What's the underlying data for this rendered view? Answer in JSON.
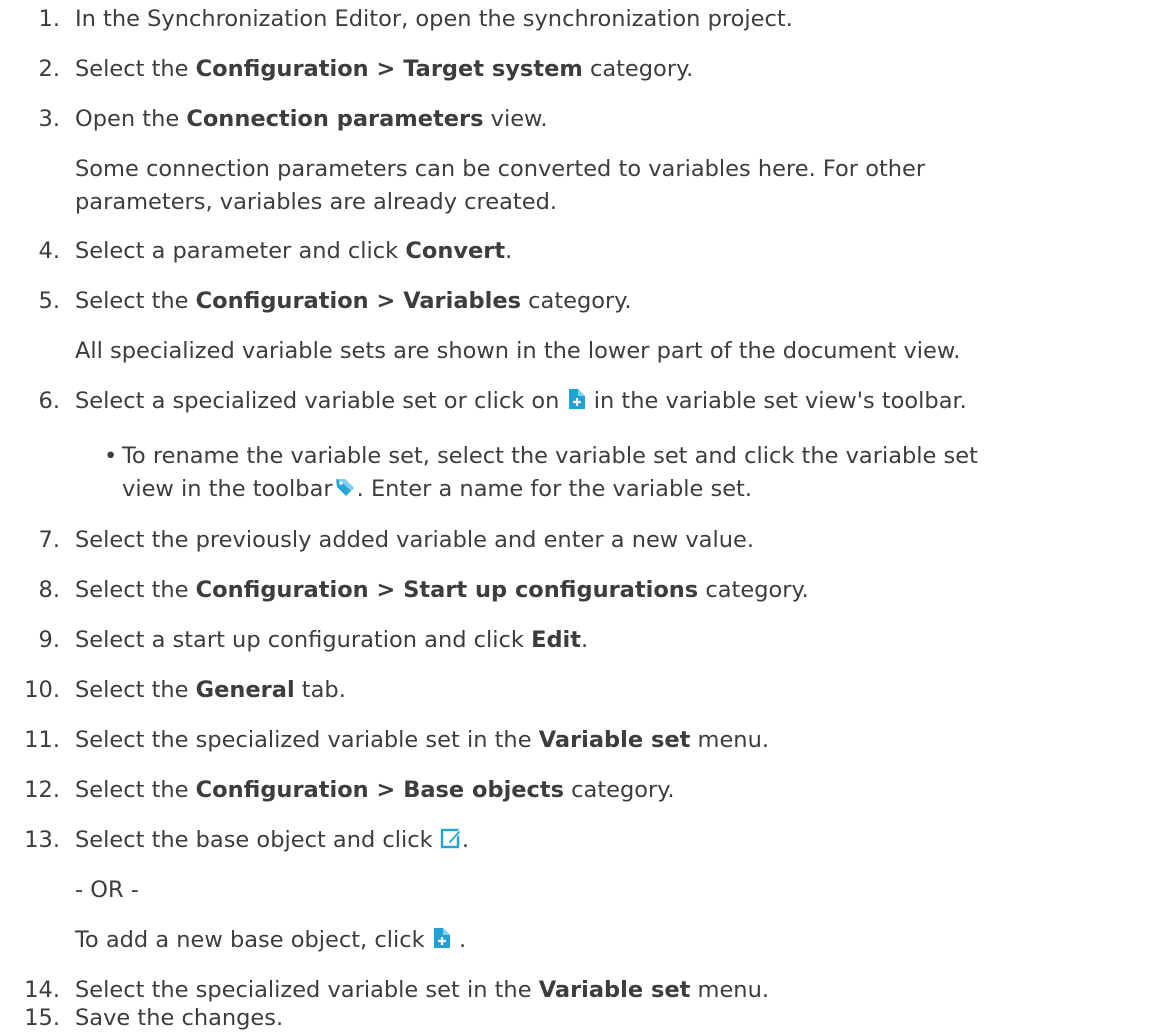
{
  "steps": [
    {
      "n": "1.",
      "parts": [
        "In the Synchronization Editor, open the synchronization project."
      ]
    },
    {
      "n": "2.",
      "parts": [
        "Select the ",
        "Configuration > Target system",
        " category."
      ]
    },
    {
      "n": "3.",
      "parts": [
        "Open the ",
        "Connection parameters",
        " view."
      ],
      "note": [
        "Some connection parameters can be converted to variables here. For other",
        "parameters, variables are already created."
      ]
    },
    {
      "n": "4.",
      "parts": [
        "Select a parameter and click ",
        "Convert",
        "."
      ]
    },
    {
      "n": "5.",
      "parts": [
        "Select the ",
        "Configuration > Variables",
        " category."
      ],
      "note": [
        "All specialized variable sets are shown in the lower part of the document view."
      ]
    },
    {
      "n": "6.",
      "parts": [
        "Select a specialized variable set or click on ",
        " in the variable set view's toolbar."
      ],
      "bullet": [
        "To rename the variable set, select the variable set and click the variable set",
        "view in the toolbar",
        ". Enter a name for the variable set."
      ]
    },
    {
      "n": "7.",
      "parts": [
        "Select the previously added variable and enter a new value."
      ]
    },
    {
      "n": "8.",
      "parts": [
        "Select the ",
        "Configuration > Start up configurations",
        " category."
      ]
    },
    {
      "n": "9.",
      "parts": [
        "Select a start up configuration and click ",
        "Edit",
        "."
      ]
    },
    {
      "n": "10.",
      "parts": [
        "Select the ",
        "General",
        " tab."
      ]
    },
    {
      "n": "11.",
      "parts": [
        "Select the specialized variable set in the ",
        "Variable set",
        " menu."
      ]
    },
    {
      "n": "12.",
      "parts": [
        "Select the ",
        "Configuration > Base objects",
        " category."
      ]
    },
    {
      "n": "13.",
      "parts": [
        "Select the base object and click ",
        "."
      ],
      "or": "- OR -",
      "alt": [
        "To add a new base object, click ",
        " ."
      ]
    },
    {
      "n": "14.",
      "parts": [
        "Select the specialized variable set in the ",
        "Variable set",
        " menu."
      ]
    },
    {
      "n": "15.",
      "parts": [
        "Save the changes."
      ]
    }
  ],
  "icons": {
    "add": {
      "name": "add-document-icon",
      "color": "#1fa3d6"
    },
    "tag": {
      "name": "tag-icon",
      "color": "#2aa6d9"
    },
    "edit": {
      "name": "edit-icon",
      "color": "#1fa3d6"
    }
  }
}
